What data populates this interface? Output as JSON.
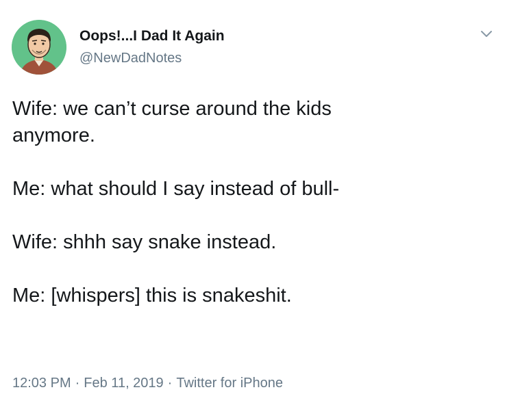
{
  "author": {
    "display_name": "Oops!...I Dad It Again",
    "handle": "@NewDadNotes",
    "avatar_icon": "cartoon-dad-avatar-icon",
    "avatar_bg": "#62c28a"
  },
  "menu": {
    "icon": "chevron-down-icon"
  },
  "tweet": {
    "line1": "Wife: we can’t curse around the kids",
    "line2": "anymore.",
    "line3": "Me: what should I say instead of bull-",
    "line4": "Wife: shhh say snake instead.",
    "line5": "Me: [whispers] this is snakeshit."
  },
  "meta": {
    "time": "12:03 PM",
    "separator": "·",
    "date": "Feb 11, 2019",
    "source": "Twitter for iPhone"
  },
  "colors": {
    "text": "#14171a",
    "secondary": "#657786"
  }
}
